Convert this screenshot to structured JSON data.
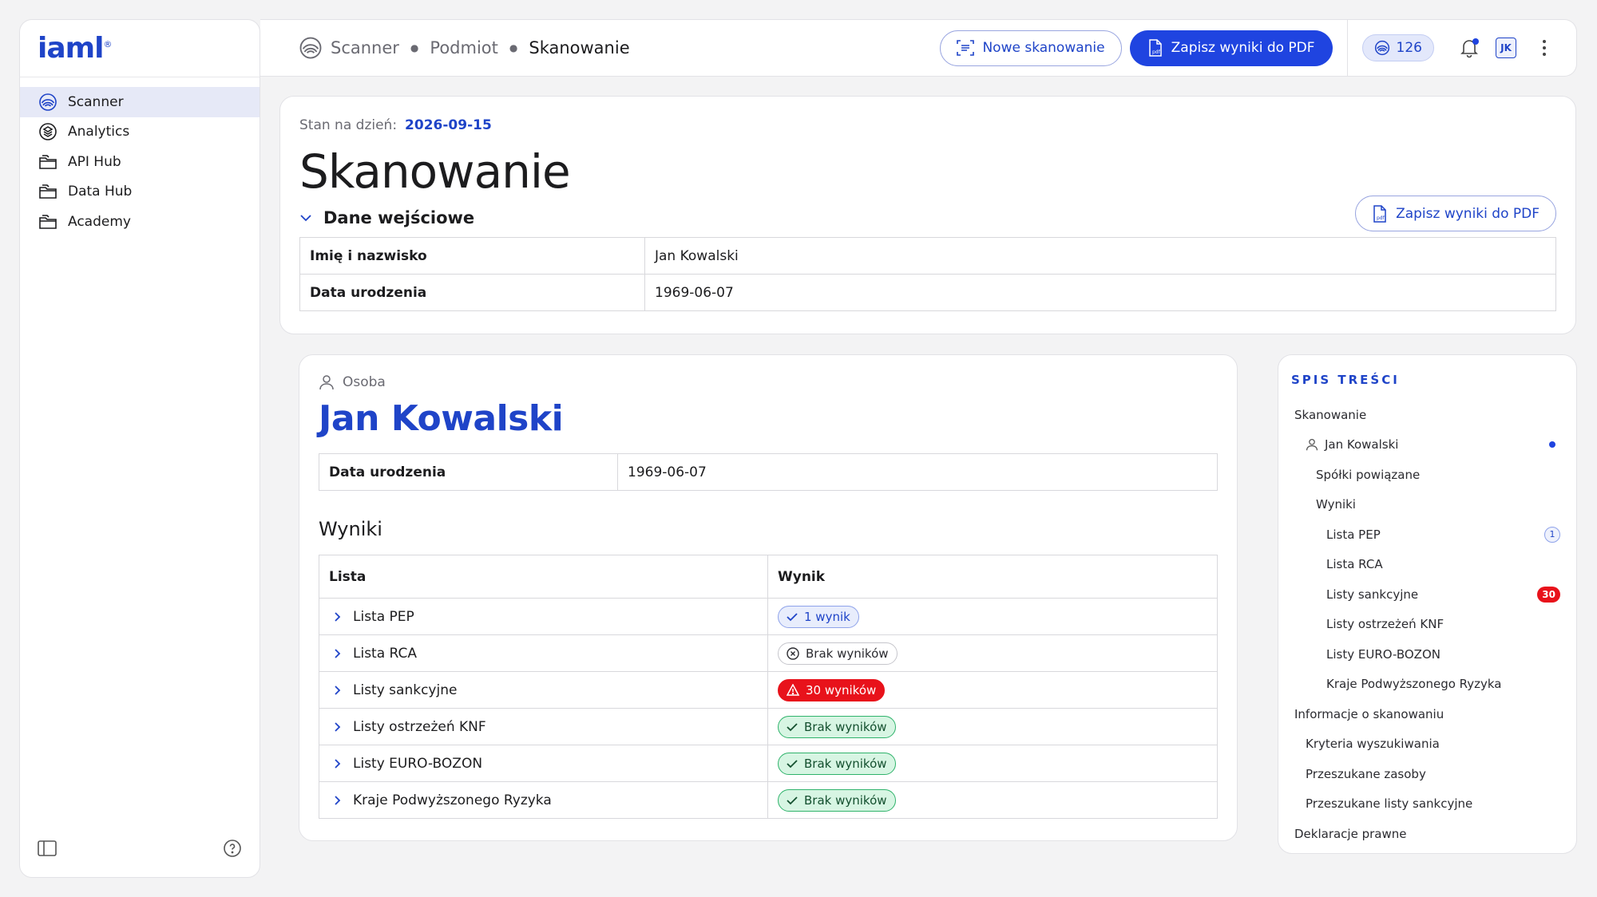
{
  "app": {
    "logo": "iaml",
    "logo_mark": "®"
  },
  "sidebar": {
    "items": [
      {
        "label": "Scanner",
        "icon": "scanner-icon",
        "active": true
      },
      {
        "label": "Analytics",
        "icon": "analytics-icon"
      },
      {
        "label": "API Hub",
        "icon": "folder-icon"
      },
      {
        "label": "Data Hub",
        "icon": "folder-icon"
      },
      {
        "label": "Academy",
        "icon": "folder-icon"
      }
    ]
  },
  "breadcrumb": {
    "items": [
      "Scanner",
      "Podmiot",
      "Skanowanie"
    ]
  },
  "topbar": {
    "new_scan_label": "Nowe skanowanie",
    "save_pdf_label": "Zapisz wyniki do PDF",
    "credits": "126",
    "avatar_initials": "JK"
  },
  "header": {
    "stan_label": "Stan na dzień:",
    "stan_date": "2026-09-15",
    "title": "Skanowanie",
    "section_label": "Dane wejściowe",
    "pdf_label": "Zapisz wyniki do PDF",
    "rows": [
      {
        "key": "Imię i nazwisko",
        "value": "Jan Kowalski"
      },
      {
        "key": "Data urodzenia",
        "value": "1969-06-07"
      }
    ]
  },
  "person": {
    "type_label": "Osoba",
    "name": "Jan Kowalski",
    "rows": [
      {
        "key": "Data urodzenia",
        "value": "1969-06-07"
      }
    ],
    "results_title": "Wyniki",
    "columns": [
      "Lista",
      "Wynik"
    ],
    "results": [
      {
        "list": "Lista PEP",
        "result": "1 wynik",
        "status": "info"
      },
      {
        "list": "Lista RCA",
        "result": "Brak wyników",
        "status": "neutral"
      },
      {
        "list": "Listy sankcyjne",
        "result": "30 wyników",
        "status": "danger"
      },
      {
        "list": "Listy ostrzeżeń KNF",
        "result": "Brak wyników",
        "status": "ok"
      },
      {
        "list": "Listy EURO-BOZON",
        "result": "Brak wyników",
        "status": "ok"
      },
      {
        "list": "Kraje Podwyższonego Ryzyka",
        "result": "Brak wyników",
        "status": "ok"
      }
    ]
  },
  "toc": {
    "title": "SPIS TREŚCI",
    "items": [
      {
        "label": "Skanowanie"
      },
      {
        "label": "Jan Kowalski"
      },
      {
        "label": "Spółki powiązane"
      },
      {
        "label": "Wyniki"
      },
      {
        "label": "Lista PEP",
        "count": "1"
      },
      {
        "label": "Lista RCA"
      },
      {
        "label": "Listy sankcyjne",
        "count": "30"
      },
      {
        "label": "Listy ostrzeżeń KNF"
      },
      {
        "label": "Listy EURO-BOZON"
      },
      {
        "label": "Kraje Podwyższonego Ryzyka"
      },
      {
        "label": "Informacje o skanowaniu"
      },
      {
        "label": "Kryteria wyszukiwania"
      },
      {
        "label": "Przeszukane zasoby"
      },
      {
        "label": "Przeszukane listy sankcyjne"
      },
      {
        "label": "Deklaracje prawne"
      }
    ]
  },
  "colors": {
    "brand": "#1f44c8",
    "primary_button": "#1f44e0",
    "danger": "#e8121b",
    "success": "#2fb36b"
  }
}
